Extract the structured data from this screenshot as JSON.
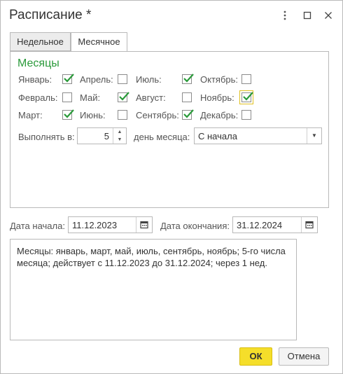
{
  "window": {
    "title": "Расписание *",
    "menu_icon": "more-vertical-icon",
    "maximize_icon": "maximize-icon",
    "close_icon": "close-icon"
  },
  "tabs": [
    {
      "label": "Недельное",
      "active": false
    },
    {
      "label": "Месячное",
      "active": true
    }
  ],
  "months_section": {
    "title": "Месяцы",
    "months": [
      {
        "label": "Январь:",
        "checked": true
      },
      {
        "label": "Апрель:",
        "checked": false
      },
      {
        "label": "Июль:",
        "checked": true
      },
      {
        "label": "Октябрь:",
        "checked": false
      },
      {
        "label": "Февраль:",
        "checked": false
      },
      {
        "label": "Май:",
        "checked": true
      },
      {
        "label": "Август:",
        "checked": false
      },
      {
        "label": "Ноябрь:",
        "checked": true
      },
      {
        "label": "Март:",
        "checked": true
      },
      {
        "label": "Июнь:",
        "checked": false
      },
      {
        "label": "Сентябрь:",
        "checked": true
      },
      {
        "label": "Декабрь:",
        "checked": false
      }
    ]
  },
  "execute": {
    "label": "Выполнять в:",
    "day_value": "5",
    "day_of_month_label": "день месяца:",
    "mode_value": "С начала"
  },
  "dates": {
    "start_label": "Дата начала:",
    "start_value": "11.12.2023",
    "end_label": "Дата окончания:",
    "end_value": "31.12.2024"
  },
  "description": "Месяцы: январь, март, май, июль, сентябрь, ноябрь; 5-го числа месяца; действует с 11.12.2023 до 31.12.2024; через 1 нед.",
  "buttons": {
    "ok": "ОК",
    "cancel": "Отмена"
  },
  "colors": {
    "accent_green": "#2a9a3a",
    "ok_button": "#f5de2a",
    "focus_outline": "#e0c020"
  }
}
